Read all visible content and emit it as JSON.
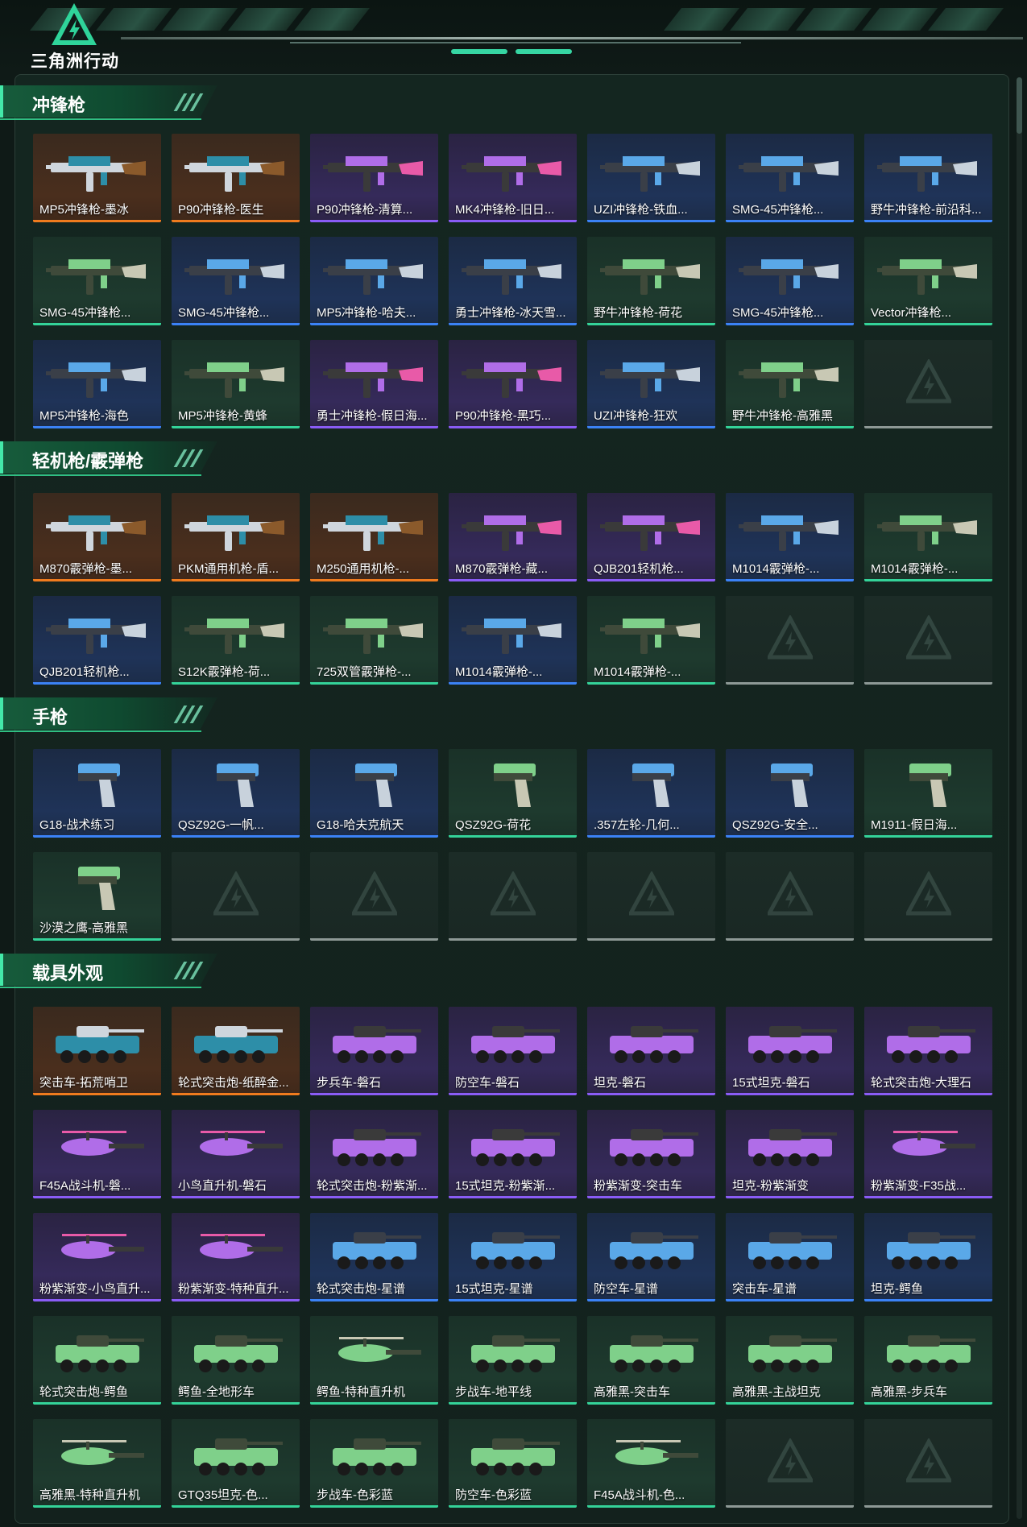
{
  "app": {
    "brand": "三角洲行动",
    "accent": "#36d6a3"
  },
  "rarity_colors": {
    "orange": "#f07b1e",
    "purple": "#8a5cf6",
    "blue": "#3b82f6",
    "green": "#34d399"
  },
  "sections": [
    {
      "title": "冲锋枪",
      "kind": "gun",
      "items": [
        {
          "label": "MP5冲锋枪-墨冰",
          "rarity": "orange"
        },
        {
          "label": "P90冲锋枪-医生",
          "rarity": "orange"
        },
        {
          "label": "P90冲锋枪-清算...",
          "rarity": "purple"
        },
        {
          "label": "MK4冲锋枪-旧日...",
          "rarity": "purple"
        },
        {
          "label": "UZI冲锋枪-铁血...",
          "rarity": "blue"
        },
        {
          "label": "SMG-45冲锋枪...",
          "rarity": "blue"
        },
        {
          "label": "野牛冲锋枪-前沿科...",
          "rarity": "blue"
        },
        {
          "label": "SMG-45冲锋枪...",
          "rarity": "green"
        },
        {
          "label": "SMG-45冲锋枪...",
          "rarity": "blue"
        },
        {
          "label": "MP5冲锋枪-哈夫...",
          "rarity": "blue"
        },
        {
          "label": "勇士冲锋枪-冰天雪...",
          "rarity": "blue"
        },
        {
          "label": "野牛冲锋枪-荷花",
          "rarity": "green"
        },
        {
          "label": "SMG-45冲锋枪...",
          "rarity": "blue"
        },
        {
          "label": "Vector冲锋枪...",
          "rarity": "green"
        },
        {
          "label": "MP5冲锋枪-海色",
          "rarity": "blue"
        },
        {
          "label": "MP5冲锋枪-黄蜂",
          "rarity": "green"
        },
        {
          "label": "勇士冲锋枪-假日海...",
          "rarity": "purple"
        },
        {
          "label": "P90冲锋枪-黑巧...",
          "rarity": "purple"
        },
        {
          "label": "UZI冲锋枪-狂欢",
          "rarity": "blue"
        },
        {
          "label": "野牛冲锋枪-高雅黑",
          "rarity": "green"
        },
        {
          "label": "",
          "rarity": "empty"
        }
      ]
    },
    {
      "title": "轻机枪/霰弹枪",
      "kind": "gun",
      "items": [
        {
          "label": "M870霰弹枪-墨...",
          "rarity": "orange"
        },
        {
          "label": "PKM通用机枪-盾...",
          "rarity": "orange"
        },
        {
          "label": "M250通用机枪-...",
          "rarity": "orange"
        },
        {
          "label": "M870霰弹枪-藏...",
          "rarity": "purple"
        },
        {
          "label": "QJB201轻机枪...",
          "rarity": "purple"
        },
        {
          "label": "M1014霰弹枪-...",
          "rarity": "blue"
        },
        {
          "label": "M1014霰弹枪-...",
          "rarity": "green"
        },
        {
          "label": "QJB201轻机枪...",
          "rarity": "blue"
        },
        {
          "label": "S12K霰弹枪-荷...",
          "rarity": "green"
        },
        {
          "label": "725双管霰弹枪-...",
          "rarity": "green"
        },
        {
          "label": "M1014霰弹枪-...",
          "rarity": "blue"
        },
        {
          "label": "M1014霰弹枪-...",
          "rarity": "green"
        },
        {
          "label": "",
          "rarity": "empty"
        },
        {
          "label": "",
          "rarity": "empty"
        }
      ]
    },
    {
      "title": "手枪",
      "kind": "pistol",
      "items": [
        {
          "label": "G18-战术练习",
          "rarity": "blue"
        },
        {
          "label": "QSZ92G-一帆...",
          "rarity": "blue"
        },
        {
          "label": "G18-哈夫克航天",
          "rarity": "blue"
        },
        {
          "label": "QSZ92G-荷花",
          "rarity": "green"
        },
        {
          "label": ".357左轮-几何...",
          "rarity": "blue"
        },
        {
          "label": "QSZ92G-安全...",
          "rarity": "blue"
        },
        {
          "label": "M1911-假日海...",
          "rarity": "green"
        },
        {
          "label": "沙漠之鹰-高雅黑",
          "rarity": "green"
        },
        {
          "label": "",
          "rarity": "empty"
        },
        {
          "label": "",
          "rarity": "empty"
        },
        {
          "label": "",
          "rarity": "empty"
        },
        {
          "label": "",
          "rarity": "empty"
        },
        {
          "label": "",
          "rarity": "empty"
        },
        {
          "label": "",
          "rarity": "empty"
        }
      ]
    },
    {
      "title": "载具外观",
      "kind": "vehicle",
      "items": [
        {
          "label": "突击车-拓荒哨卫",
          "rarity": "orange"
        },
        {
          "label": "轮式突击炮-纸醉金...",
          "rarity": "orange"
        },
        {
          "label": "步兵车-磐石",
          "rarity": "purple"
        },
        {
          "label": "防空车-磐石",
          "rarity": "purple"
        },
        {
          "label": "坦克-磐石",
          "rarity": "purple"
        },
        {
          "label": "15式坦克-磐石",
          "rarity": "purple"
        },
        {
          "label": "轮式突击炮-大理石",
          "rarity": "purple"
        },
        {
          "label": "F45A战斗机-磐...",
          "rarity": "purple"
        },
        {
          "label": "小鸟直升机-磐石",
          "rarity": "purple"
        },
        {
          "label": "轮式突击炮-粉紫渐...",
          "rarity": "purple"
        },
        {
          "label": "15式坦克-粉紫渐...",
          "rarity": "purple"
        },
        {
          "label": "粉紫渐变-突击车",
          "rarity": "purple"
        },
        {
          "label": "坦克-粉紫渐变",
          "rarity": "purple"
        },
        {
          "label": "粉紫渐变-F35战...",
          "rarity": "purple"
        },
        {
          "label": "粉紫渐变-小鸟直升...",
          "rarity": "purple"
        },
        {
          "label": "粉紫渐变-特种直升...",
          "rarity": "purple"
        },
        {
          "label": "轮式突击炮-星谱",
          "rarity": "blue"
        },
        {
          "label": "15式坦克-星谱",
          "rarity": "blue"
        },
        {
          "label": "防空车-星谱",
          "rarity": "blue"
        },
        {
          "label": "突击车-星谱",
          "rarity": "blue"
        },
        {
          "label": "坦克-鳄鱼",
          "rarity": "blue"
        },
        {
          "label": "轮式突击炮-鳄鱼",
          "rarity": "green"
        },
        {
          "label": "鳄鱼-全地形车",
          "rarity": "green"
        },
        {
          "label": "鳄鱼-特种直升机",
          "rarity": "green"
        },
        {
          "label": "步战车-地平线",
          "rarity": "green"
        },
        {
          "label": "高雅黑-突击车",
          "rarity": "green"
        },
        {
          "label": "高雅黑-主战坦克",
          "rarity": "green"
        },
        {
          "label": "高雅黑-步兵车",
          "rarity": "green"
        },
        {
          "label": "高雅黑-特种直升机",
          "rarity": "green"
        },
        {
          "label": "GTQ35坦克-色...",
          "rarity": "green"
        },
        {
          "label": "步战车-色彩蓝",
          "rarity": "green"
        },
        {
          "label": "防空车-色彩蓝",
          "rarity": "green"
        },
        {
          "label": "F45A战斗机-色...",
          "rarity": "green"
        },
        {
          "label": "",
          "rarity": "empty"
        },
        {
          "label": "",
          "rarity": "empty"
        }
      ]
    }
  ]
}
